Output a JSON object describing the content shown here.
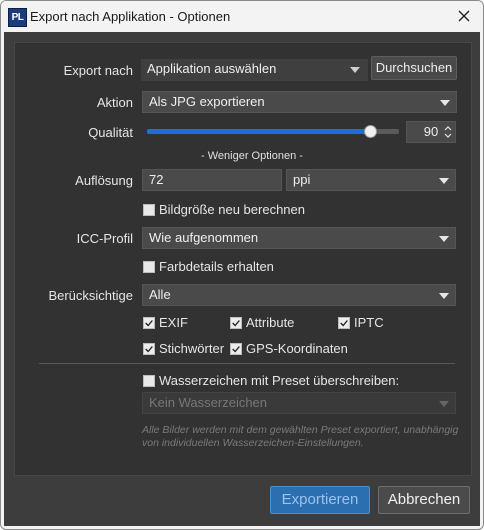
{
  "window": {
    "title": "Export nach Applikation - Optionen",
    "app_icon_text": "PL"
  },
  "export_to": {
    "label": "Export nach",
    "value": "Applikation auswählen",
    "browse_label": "Durchsuchen"
  },
  "action": {
    "label": "Aktion",
    "value": "Als JPG exportieren"
  },
  "quality": {
    "label": "Qualität",
    "value": "90",
    "percent": 90
  },
  "fewer_options": "- Weniger Optionen -",
  "resolution": {
    "label": "Auflösung",
    "value": "72",
    "unit": "ppi"
  },
  "resize": {
    "label": "Bildgröße neu berechnen",
    "checked": false
  },
  "icc": {
    "label": "ICC-Profil",
    "value": "Wie aufgenommen"
  },
  "color_details": {
    "label": "Farbdetails erhalten",
    "checked": false
  },
  "consider": {
    "label": "Berücksichtige",
    "value": "Alle"
  },
  "metadata": {
    "exif": {
      "label": "EXIF",
      "checked": true
    },
    "attribute": {
      "label": "Attribute",
      "checked": true
    },
    "iptc": {
      "label": "IPTC",
      "checked": true
    },
    "keywords": {
      "label": "Stichwörter",
      "checked": true
    },
    "gps": {
      "label": "GPS-Koordinaten",
      "checked": true
    }
  },
  "watermark": {
    "label": "Wasserzeichen mit Preset überschreiben:",
    "checked": false,
    "select_value": "Kein Wasserzeichen",
    "note": "Alle Bilder werden mit dem gewählten Preset exportiert, unabhängig von individuellen Wasserzeichen-Einstellungen."
  },
  "footer": {
    "export_label": "Exportieren",
    "cancel_label": "Abbrechen"
  },
  "colors": {
    "accent": "#1d6fd6",
    "dialog_bg": "#3d3d3d",
    "panel_bg": "#323232"
  }
}
